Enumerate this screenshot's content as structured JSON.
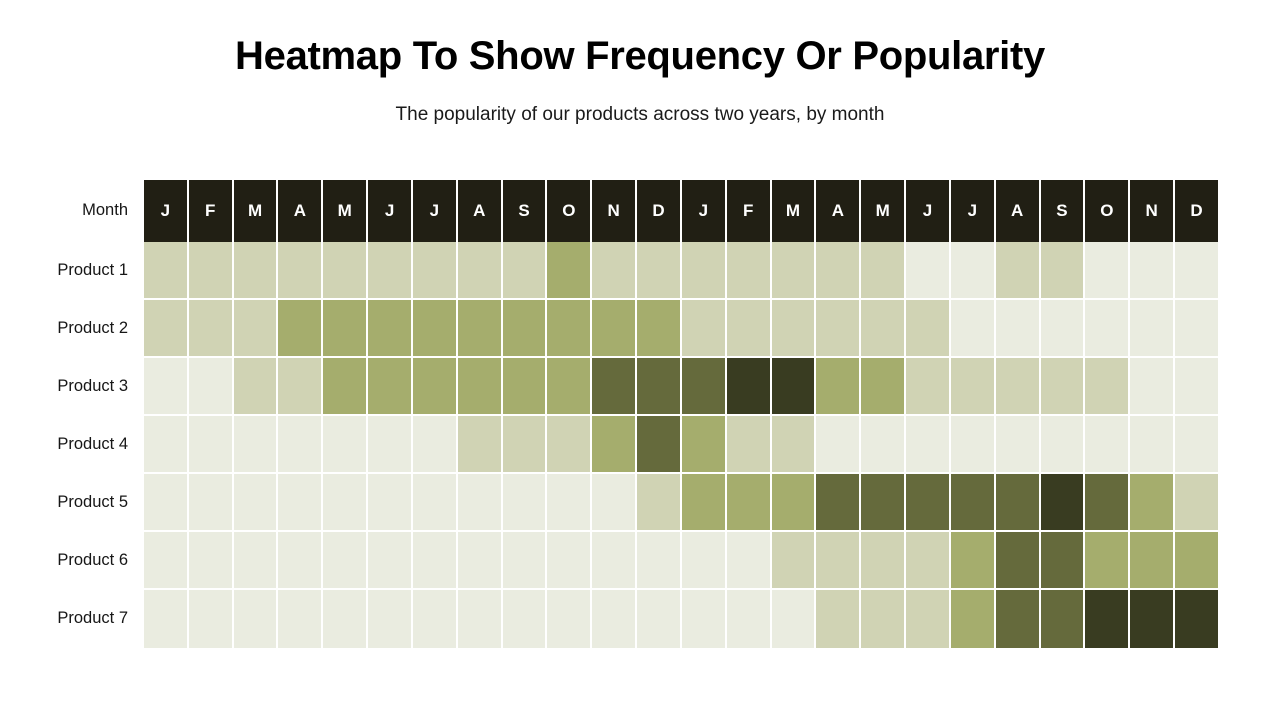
{
  "chart_data": {
    "type": "heatmap",
    "title": "Heatmap To Show Frequency Or Popularity",
    "subtitle": "The popularity of our products across two years, by month",
    "xlabel": "Month",
    "ylabel": "",
    "legend_position": "none",
    "grid": true,
    "x_axis_caption": "Month",
    "categories": [
      "J",
      "F",
      "M",
      "A",
      "M",
      "J",
      "J",
      "A",
      "S",
      "O",
      "N",
      "D",
      "J",
      "F",
      "M",
      "A",
      "M",
      "J",
      "J",
      "A",
      "S",
      "O",
      "N",
      "D"
    ],
    "rows": [
      "Product 1",
      "Product 2",
      "Product 3",
      "Product 4",
      "Product 5",
      "Product 6",
      "Product 7"
    ],
    "scale_levels": [
      0,
      1,
      2,
      3,
      4
    ],
    "palette": [
      "#eaece0",
      "#d0d3b4",
      "#a5ad6d",
      "#656a3c",
      "#393c21"
    ],
    "header_background": "#211f14",
    "header_text_color": "#ffffff",
    "gridline_color": "#ffffff",
    "values": [
      [
        1,
        1,
        1,
        1,
        1,
        1,
        1,
        1,
        1,
        2,
        1,
        1,
        1,
        1,
        1,
        1,
        1,
        0,
        0,
        1,
        1,
        0,
        0,
        0
      ],
      [
        1,
        1,
        1,
        2,
        2,
        2,
        2,
        2,
        2,
        2,
        2,
        2,
        1,
        1,
        1,
        1,
        1,
        1,
        0,
        0,
        0,
        0,
        0,
        0
      ],
      [
        0,
        0,
        1,
        1,
        2,
        2,
        2,
        2,
        2,
        2,
        3,
        3,
        3,
        4,
        4,
        2,
        2,
        1,
        1,
        1,
        1,
        1,
        0,
        0
      ],
      [
        0,
        0,
        0,
        0,
        0,
        0,
        0,
        1,
        1,
        1,
        2,
        3,
        2,
        1,
        1,
        0,
        0,
        0,
        0,
        0,
        0,
        0,
        0,
        0
      ],
      [
        0,
        0,
        0,
        0,
        0,
        0,
        0,
        0,
        0,
        0,
        0,
        1,
        2,
        2,
        2,
        3,
        3,
        3,
        3,
        3,
        4,
        3,
        2,
        1
      ],
      [
        0,
        0,
        0,
        0,
        0,
        0,
        0,
        0,
        0,
        0,
        0,
        0,
        0,
        0,
        1,
        1,
        1,
        1,
        2,
        3,
        3,
        2,
        2,
        2
      ],
      [
        0,
        0,
        0,
        0,
        0,
        0,
        0,
        0,
        0,
        0,
        0,
        0,
        0,
        0,
        0,
        1,
        1,
        1,
        2,
        3,
        3,
        4,
        4,
        4
      ]
    ]
  }
}
